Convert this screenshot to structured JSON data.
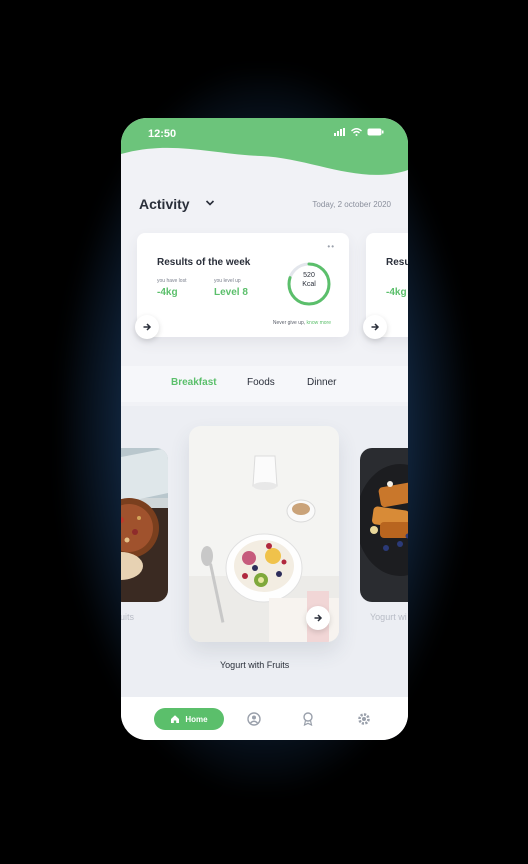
{
  "status": {
    "time": "12:50",
    "icons": [
      "signal-icon",
      "wifi-icon",
      "battery-icon"
    ]
  },
  "header": {
    "title": "Activity",
    "date": "Today, 2 october 2020"
  },
  "results": {
    "title": "Results of the week",
    "lost_label": "you have lost",
    "lost_value": "-4kg",
    "level_label": "you level up",
    "level_value": "Level 8",
    "kcal_value": "520",
    "kcal_unit": "Kcal",
    "kcal_progress": 0.8,
    "footer_text": "Never give up,",
    "footer_link": "know more",
    "menu_dots": "••",
    "second_title": "Resu",
    "second_value": "-4kg"
  },
  "tabs": [
    {
      "label": "Breakfast",
      "active": true
    },
    {
      "label": "Foods",
      "active": false
    },
    {
      "label": "Dinner",
      "active": false
    }
  ],
  "foods": {
    "left_name": "ruits",
    "center_name": "Yogurt with Fruits",
    "right_name": "Yogurt wi"
  },
  "nav": {
    "home_label": "Home",
    "items": [
      "home-icon",
      "profile-icon",
      "award-icon",
      "settings-icon"
    ]
  },
  "colors": {
    "accent": "#5bbf6b",
    "background": "#f1f2f6",
    "text": "#2a2f3a"
  }
}
